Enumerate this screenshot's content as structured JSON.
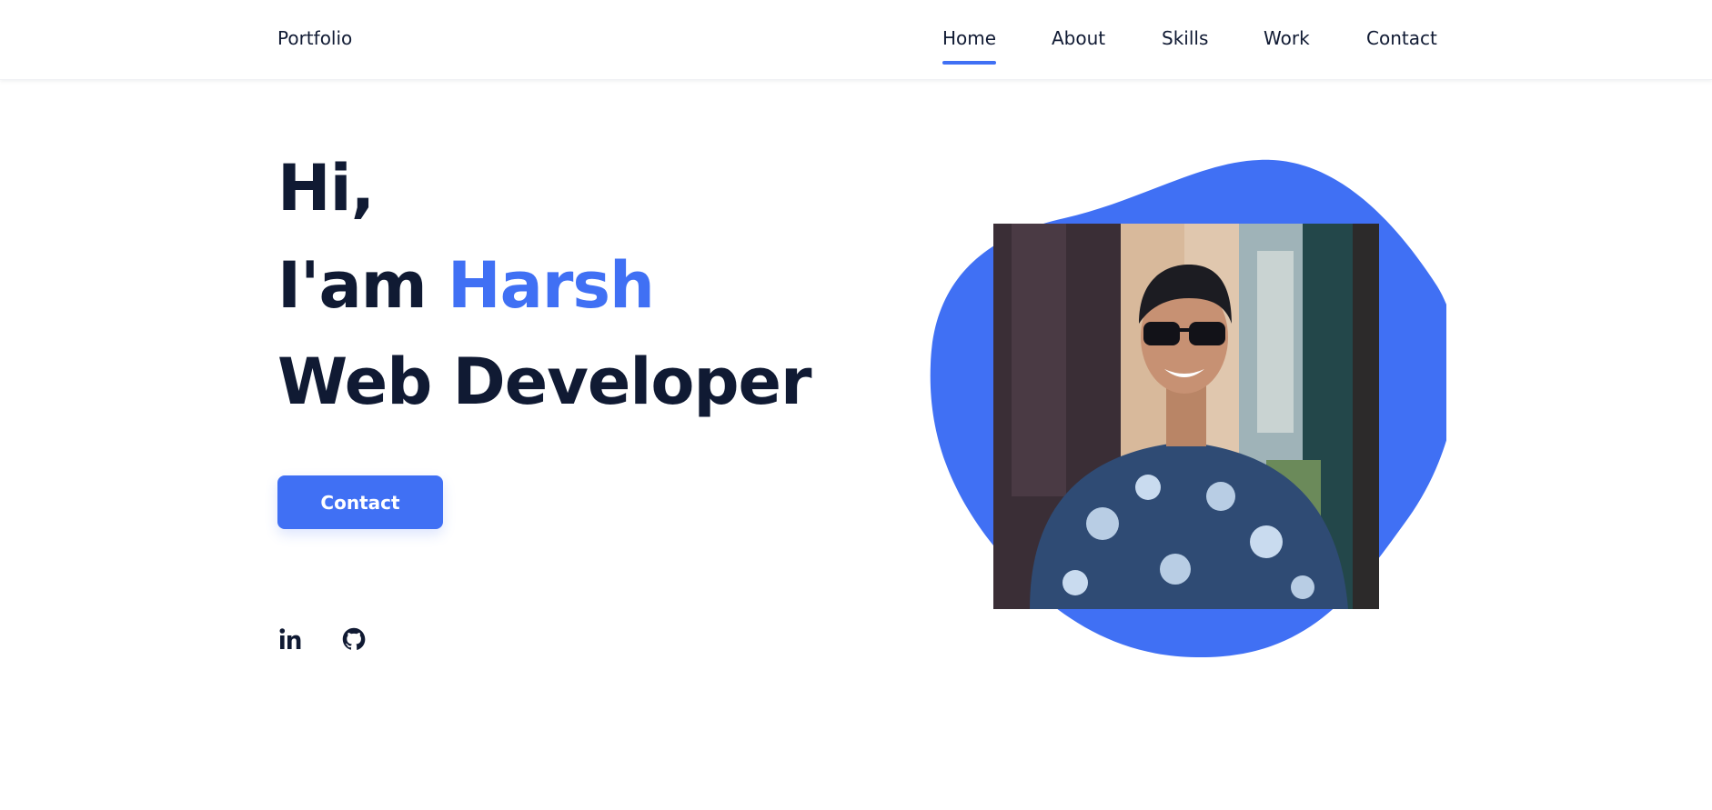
{
  "header": {
    "logo": "Portfolio",
    "nav": {
      "home": "Home",
      "about": "About",
      "skills": "Skills",
      "work": "Work",
      "contact": "Contact"
    },
    "active_item": "Home"
  },
  "hero": {
    "line1": "Hi,",
    "line2_prefix": "I'am",
    "line2_name": "Harsh",
    "line3": "Web Developer",
    "cta_label": "Contact"
  },
  "social": [
    "linkedin-icon",
    "github-icon"
  ],
  "colors": {
    "accent": "#4070f4",
    "text": "#101a33",
    "background": "#ffffff"
  },
  "icons": {
    "linkedin": "linkedin-icon",
    "github": "github-icon"
  }
}
